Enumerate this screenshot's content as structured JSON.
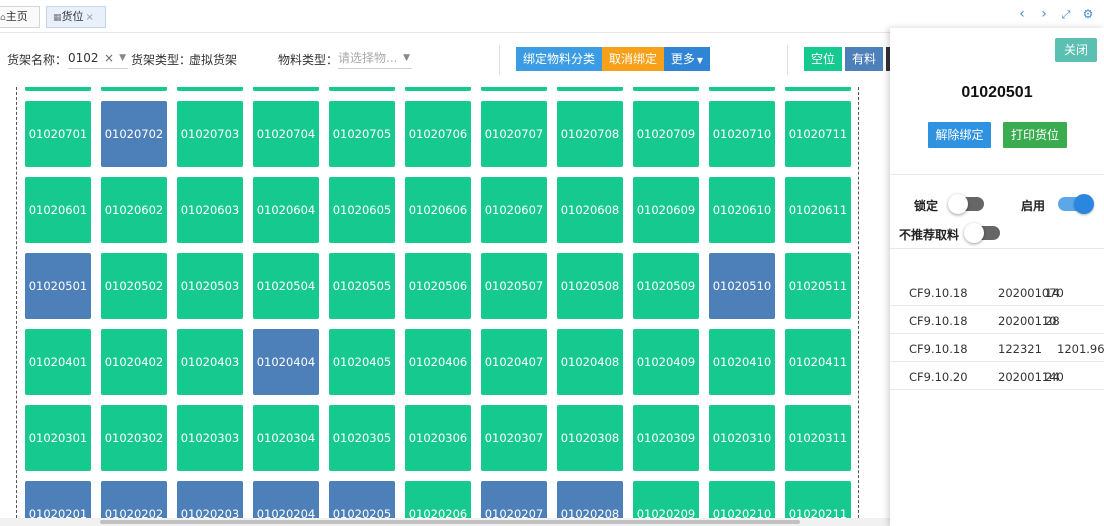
{
  "tabs": {
    "home": {
      "icon": "home-icon",
      "label": "主页"
    },
    "active": {
      "icon": "grid-icon",
      "label": "货位",
      "close": "×"
    }
  },
  "window_controls": [
    "chevron-left-icon",
    "chevron-right-icon",
    "fullscreen-icon",
    "gear-icon"
  ],
  "toolbar": {
    "rack_name_label": "货架名称：",
    "rack_name_value": "0102",
    "rack_clear": "×",
    "rack_type_label": "货架类型：",
    "rack_type_value": "虚拟货架",
    "material_type_label": "物料类型：",
    "material_type_placeholder": "请选择物...",
    "bind_button": "绑定物料分类",
    "unbind_button": "取消绑定",
    "more_button": "更多",
    "legend_empty": "空位",
    "legend_full": "有料"
  },
  "colors": {
    "empty": "#16c98e",
    "full": "#4d80b9",
    "bind_button": "#3c9ce3",
    "unbind_button": "#f7a11a",
    "more_button": "#2f84d3",
    "unbind_panel_button": "#2f92e0",
    "print_button": "#3aab4e"
  },
  "grid": {
    "rows": [
      {
        "cells": [
          "",
          "",
          "",
          "",
          "",
          "",
          "",
          "",
          "",
          "",
          ""
        ],
        "full": []
      },
      {
        "cells": [
          "01020701",
          "01020702",
          "01020703",
          "01020704",
          "01020705",
          "01020706",
          "01020707",
          "01020708",
          "01020709",
          "01020710",
          "01020711"
        ],
        "full": [
          1
        ]
      },
      {
        "cells": [
          "01020601",
          "01020602",
          "01020603",
          "01020604",
          "01020605",
          "01020606",
          "01020607",
          "01020608",
          "01020609",
          "01020610",
          "01020611"
        ],
        "full": []
      },
      {
        "cells": [
          "01020501",
          "01020502",
          "01020503",
          "01020504",
          "01020505",
          "01020506",
          "01020507",
          "01020508",
          "01020509",
          "01020510",
          "01020511"
        ],
        "full": [
          0,
          9
        ]
      },
      {
        "cells": [
          "01020401",
          "01020402",
          "01020403",
          "01020404",
          "01020405",
          "01020406",
          "01020407",
          "01020408",
          "01020409",
          "01020410",
          "01020411"
        ],
        "full": [
          3
        ]
      },
      {
        "cells": [
          "01020301",
          "01020302",
          "01020303",
          "01020304",
          "01020305",
          "01020306",
          "01020307",
          "01020308",
          "01020309",
          "01020310",
          "01020311"
        ],
        "full": []
      },
      {
        "cells": [
          "01020201",
          "01020202",
          "01020203",
          "01020204",
          "01020205",
          "01020206",
          "01020207",
          "01020208",
          "01020209",
          "01020210",
          "01020211"
        ],
        "full": [
          0,
          1,
          2,
          3,
          4,
          6,
          7
        ]
      }
    ]
  },
  "panel": {
    "close_button": "关闭",
    "title": "01020501",
    "unbind_button": "解除绑定",
    "print_button": "打印货位",
    "lock_label": "锁定",
    "lock_on": false,
    "enable_label": "启用",
    "enable_on": true,
    "no_recommend_label": "不推荐取料",
    "no_recommend_on": false,
    "items": [
      {
        "code": "CF9.10.18",
        "batch": "202001070",
        "qty": "14",
        "extra": ""
      },
      {
        "code": "CF9.10.18",
        "batch": "20200110",
        "qty": "28",
        "extra": ""
      },
      {
        "code": "CF9.10.18",
        "batch": "122321",
        "qty": "",
        "extra": "1201.96"
      },
      {
        "code": "CF9.10.20",
        "batch": "202001140",
        "qty": "24",
        "extra": ""
      }
    ]
  }
}
